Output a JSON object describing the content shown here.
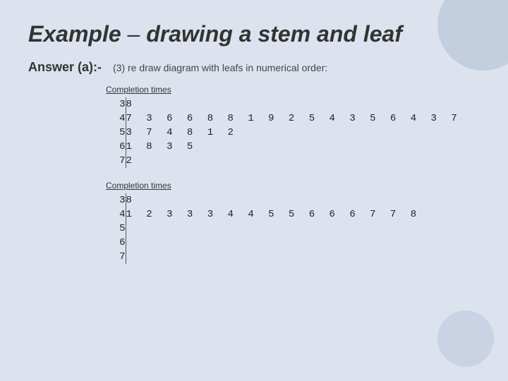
{
  "title": {
    "main": "Example",
    "dash": "–",
    "sub": "drawing a stem and leaf"
  },
  "answer": {
    "label": "Answer (a):-",
    "instruction": "(3)  re draw diagram with leafs in numerical order:"
  },
  "table1": {
    "section_title": "Completion times",
    "rows": [
      {
        "stem": "3",
        "leaves": "8"
      },
      {
        "stem": "4",
        "leaves": "7 3 6 6 8 8 1 9 2 5 4 3 5 6 4 3 7"
      },
      {
        "stem": "5",
        "leaves": "3 7 4 8 1 2"
      },
      {
        "stem": "6",
        "leaves": "1 8 3 5"
      },
      {
        "stem": "7",
        "leaves": "2"
      }
    ]
  },
  "table2": {
    "section_title": "Completion times",
    "rows": [
      {
        "stem": "3",
        "leaves": "8"
      },
      {
        "stem": "4",
        "leaves": "1 2 3 3 3 4 4 5 5 6 6 6 7 7 8"
      },
      {
        "stem": "5",
        "leaves": ""
      },
      {
        "stem": "6",
        "leaves": ""
      },
      {
        "stem": "7",
        "leaves": ""
      }
    ]
  }
}
